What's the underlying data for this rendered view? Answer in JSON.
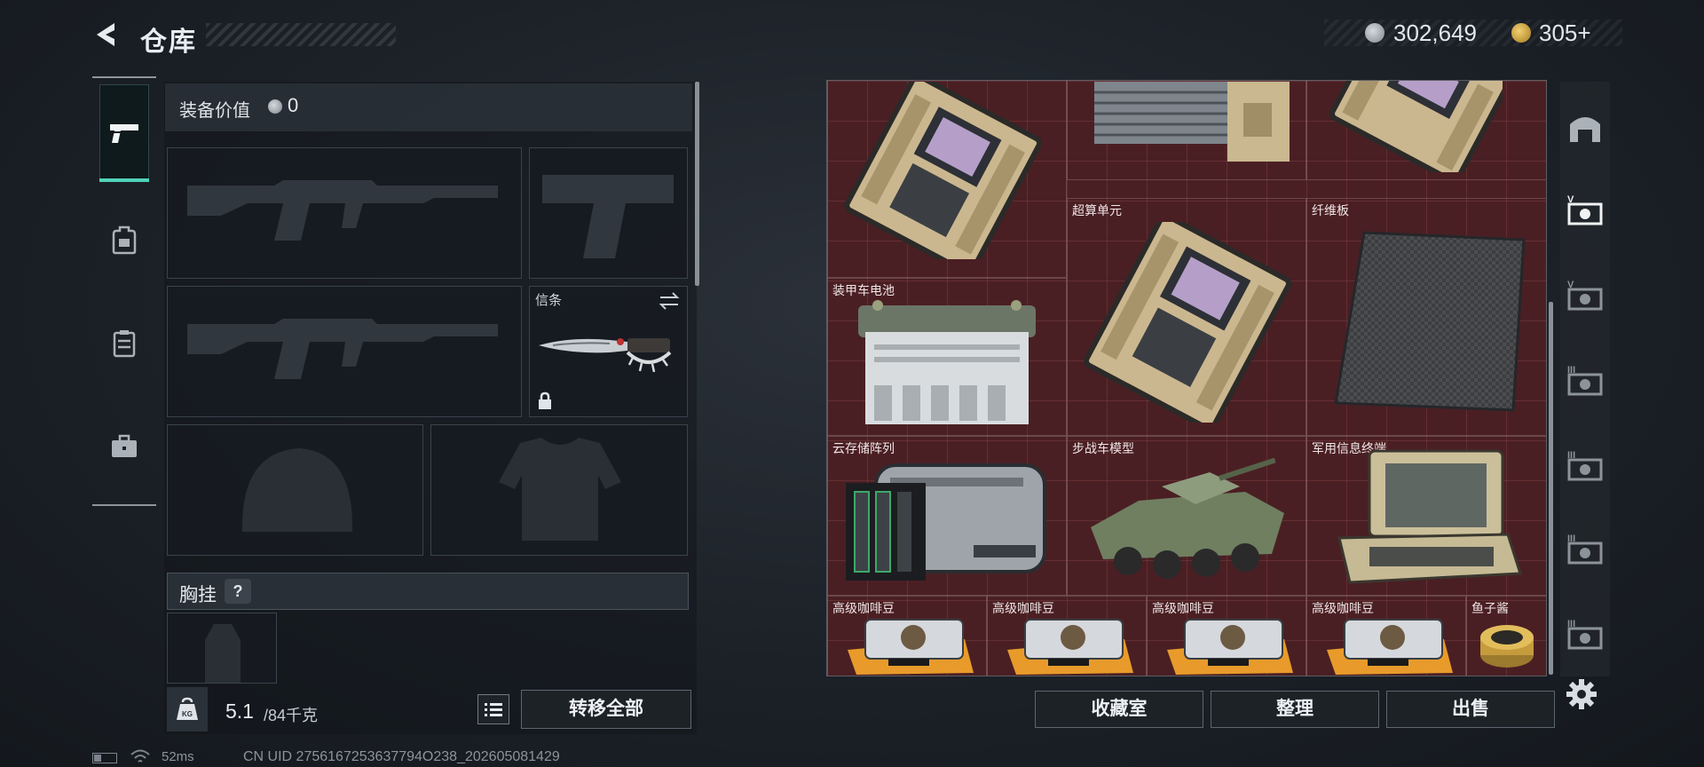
{
  "header": {
    "title": "仓库"
  },
  "currency": {
    "silver": "302,649",
    "gold": "305+"
  },
  "left_panel": {
    "equip_value_label": "装备价值",
    "equip_value": "0",
    "slots": {
      "melee_label": "信条"
    },
    "chest_label": "胸挂",
    "chest_help": "?",
    "weight_current": "5.1",
    "weight_max": "/84千克",
    "transfer_all": "转移全部"
  },
  "footer": {
    "ping": "52ms",
    "uid": "CN UID 2756167253637794O238_202605081429"
  },
  "stash": {
    "items": [
      {
        "label": ""
      },
      {
        "label": ""
      },
      {
        "label": ""
      },
      {
        "label": "超算单元"
      },
      {
        "label": "纤维板"
      },
      {
        "label": "装甲车电池"
      },
      {
        "label": "云存储阵列"
      },
      {
        "label": "步战车模型"
      },
      {
        "label": "军用信息终端"
      },
      {
        "label": "高级咖啡豆"
      },
      {
        "label": "高级咖啡豆"
      },
      {
        "label": "高级咖啡豆"
      },
      {
        "label": "高级咖啡豆"
      },
      {
        "label": "鱼子酱"
      }
    ]
  },
  "actions": {
    "collection": "收藏室",
    "sort": "整理",
    "sell": "出售"
  },
  "icons": {
    "back": "back-arrow-icon",
    "silver": "silver-coin-icon",
    "gold": "gold-coin-icon",
    "weapon": "pistol-icon",
    "backpack": "backpack-icon",
    "vest": "vest-icon",
    "case": "briefcase-icon",
    "weight": "weight-icon",
    "list": "list-icon",
    "settings": "gear-icon"
  },
  "colors": {
    "accent": "#4fd3b8",
    "grid_bg": "#4a1f23"
  }
}
